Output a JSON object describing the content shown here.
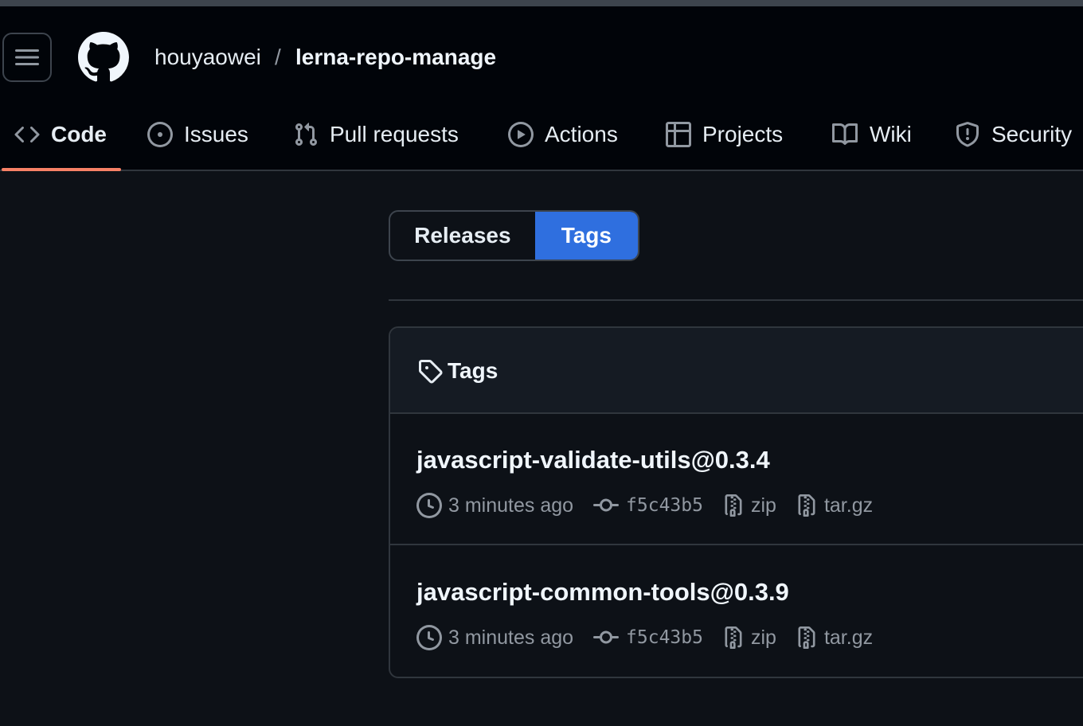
{
  "header": {
    "owner": "houyaowei",
    "separator": "/",
    "repo": "lerna-repo-manage",
    "icons": [
      "hamburger-menu-icon",
      "github-logo-icon"
    ]
  },
  "nav": {
    "tabs": [
      {
        "label": "Code",
        "icon": "code-icon",
        "active": true
      },
      {
        "label": "Issues",
        "icon": "issue-opened-icon"
      },
      {
        "label": "Pull requests",
        "icon": "git-pull-request-icon"
      },
      {
        "label": "Actions",
        "icon": "play-icon"
      },
      {
        "label": "Projects",
        "icon": "table-icon"
      },
      {
        "label": "Wiki",
        "icon": "book-icon"
      },
      {
        "label": "Security",
        "icon": "shield-icon"
      }
    ],
    "active_underline_color": "#f78166"
  },
  "segmented": {
    "releases_label": "Releases",
    "tags_label": "Tags",
    "selected": "Tags",
    "selected_color": "#2f6fdf"
  },
  "tags_box": {
    "title": "Tags",
    "icon": "tag-icon",
    "items": [
      {
        "name": "javascript-validate-utils@0.3.4",
        "time": "3 minutes ago",
        "commit": "f5c43b5",
        "zip": "zip",
        "targz": "tar.gz"
      },
      {
        "name": "javascript-common-tools@0.3.9",
        "time": "3 minutes ago",
        "commit": "f5c43b5",
        "zip": "zip",
        "targz": "tar.gz"
      }
    ]
  }
}
